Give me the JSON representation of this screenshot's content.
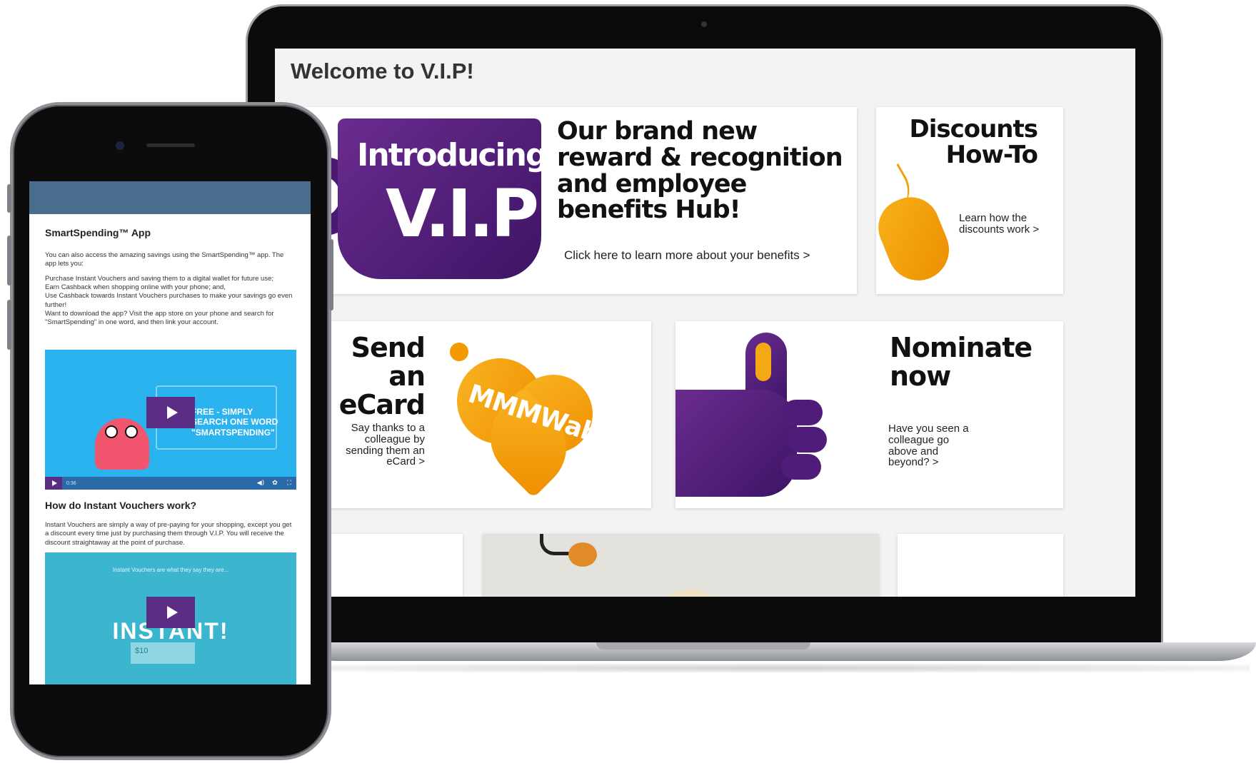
{
  "laptop": {
    "page_title": "Welcome to V.I.P!",
    "hero": {
      "mug_line_1": "Introducing",
      "mug_line_2": "V.I.P",
      "headline": "Our brand new reward & recognition and employee benefits Hub!",
      "link": "Click here to learn more about your benefits >"
    },
    "discounts": {
      "title_line_1": "Discounts",
      "title_line_2": "How-To",
      "link": "Learn how the discounts work >"
    },
    "ecard": {
      "title_line_1": "Send an",
      "title_line_2": "eCard",
      "heart_text": "MMMWah!",
      "link": "Say thanks to a colleague by sending them an eCard >"
    },
    "nominate": {
      "title_line_1": "Nominate",
      "title_line_2": "now",
      "link": "Have you seen a colleague go above and beyond? >"
    }
  },
  "phone": {
    "section_1_title": "SmartSpending™ App",
    "section_1_intro": "You can also access the amazing savings using the SmartSpending™ app. The app lets you:",
    "section_1_items": [
      "Purchase Instant Vouchers and saving them to a digital wallet for future use;",
      "Earn Cashback when shopping online with your phone; and,",
      "Use Cashback towards Instant Vouchers purchases to make your savings go even further!",
      "Want to download the app? Visit the app store on your phone and search for \"SmartSpending\" in one word, and then link your account."
    ],
    "video_1": {
      "overlay_text": "FREE - SIMPLY SEARCH ONE WORD \"SMARTSPENDING\"",
      "time": "0:36"
    },
    "section_2_title": "How do Instant Vouchers work?",
    "section_2_text": "Instant Vouchers are simply a way of pre-paying for your shopping, except you get a discount every time just by purchasing them through V.I.P. You will receive the discount straightaway at the point of purchase.",
    "video_2": {
      "caption": "Instant Vouchers are what they say they are...",
      "big_text": "INSTANT!",
      "amount": "$10"
    }
  },
  "colors": {
    "purple": "#5b2c83",
    "orange": "#f5a316",
    "phone_header": "#4a6d8e",
    "video_blue": "#2bb3f0",
    "video_teal": "#3cb5cf"
  },
  "icons": [
    "play-icon",
    "volume-icon",
    "settings-icon",
    "fullscreen-icon"
  ]
}
